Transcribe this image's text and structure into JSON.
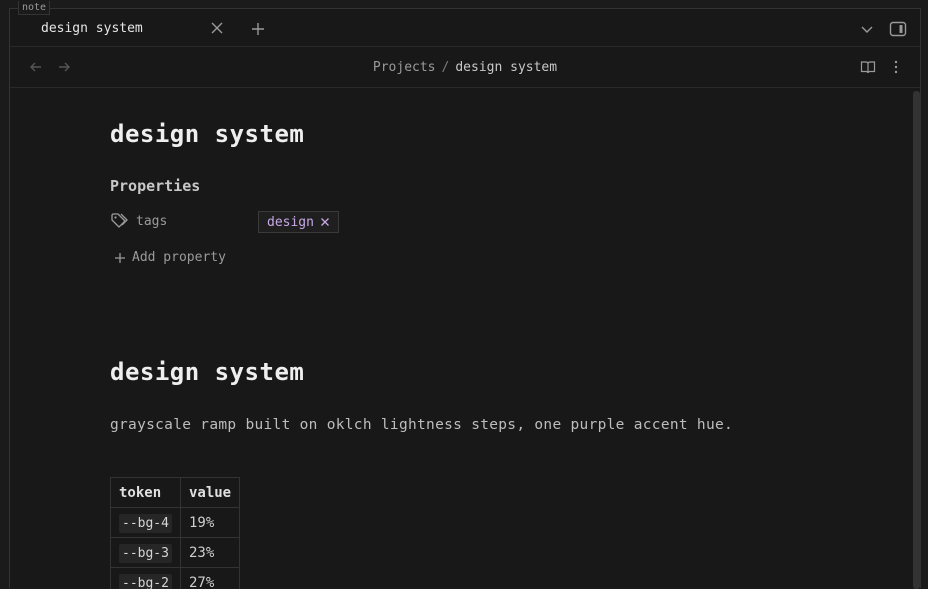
{
  "window_label": "note",
  "tab": {
    "title": "design system"
  },
  "breadcrumb": {
    "parent": "Projects",
    "separator": "/",
    "current": "design system"
  },
  "note": {
    "title": "design system",
    "properties_heading": "Properties",
    "properties": [
      {
        "name": "tags",
        "tags": [
          "design"
        ]
      }
    ],
    "add_property_label": "Add property",
    "heading": "design system",
    "paragraph": "grayscale ramp built on oklch lightness steps, one purple accent hue.",
    "table": {
      "headers": [
        "token",
        "value"
      ],
      "rows": [
        {
          "token": "--bg-4",
          "value": "19%"
        },
        {
          "token": "--bg-3",
          "value": "23%"
        },
        {
          "token": "--bg-2",
          "value": "27%"
        }
      ]
    }
  },
  "colors": {
    "background": "#181818",
    "accent": "#c7a8e6",
    "text": "#d8d8d8"
  }
}
